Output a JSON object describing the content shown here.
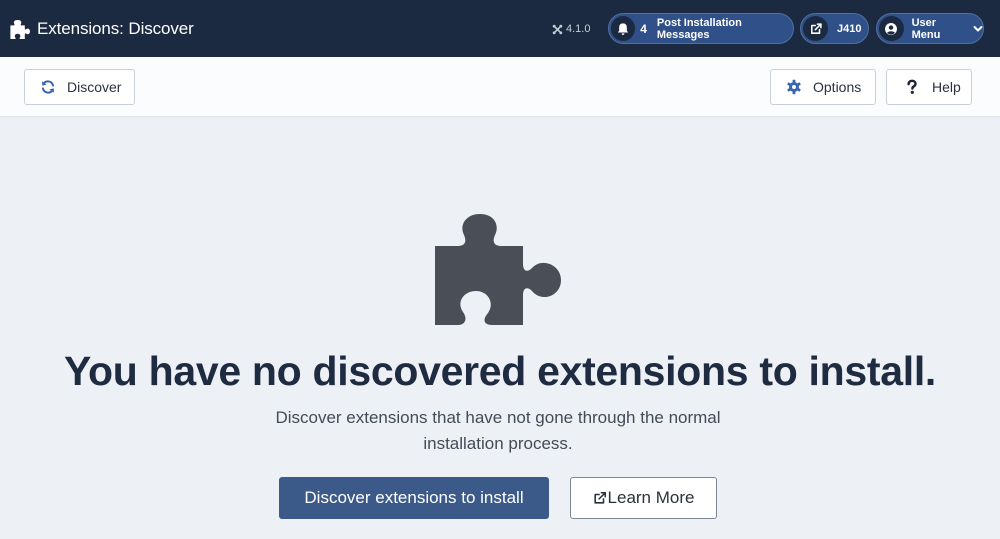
{
  "header": {
    "title": "Extensions: Discover",
    "version": "4.1.0",
    "messages": {
      "count": "4",
      "label": "Post Installation Messages"
    },
    "site": {
      "label": "J410"
    },
    "user_menu": {
      "label": "User Menu"
    }
  },
  "toolbar": {
    "discover_label": "Discover",
    "options_label": "Options",
    "help_label": "Help"
  },
  "empty_state": {
    "icon": "puzzle-piece-icon",
    "title": "You have no discovered extensions to install.",
    "description": "Discover extensions that have not gone through the normal installation process.",
    "primary_label": "Discover extensions to install",
    "learn_more_label": "Learn More"
  },
  "colors": {
    "header_bg": "#1c2a41",
    "pill_bg": "#2f5089",
    "page_bg": "#edf1f6",
    "primary": "#3c5a89",
    "title_text": "#1e2b40",
    "icon_gray": "#4a4f57",
    "accent_icon": "#3a65b0"
  }
}
